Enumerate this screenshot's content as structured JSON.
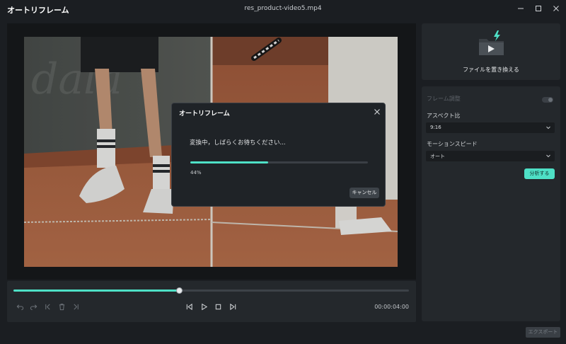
{
  "window": {
    "app_title": "オートリフレーム",
    "file_name": "res_product-video5.mp4",
    "controls": [
      "minimize-icon",
      "maximize-icon",
      "close-icon"
    ]
  },
  "player": {
    "timecode": "00:00:04:00",
    "progress": 0.42,
    "buttons": [
      "undo-icon",
      "redo-icon",
      "split-start-icon",
      "delete-icon",
      "split-end-icon",
      "step-back-icon",
      "play-icon",
      "stop-icon",
      "step-forward-icon"
    ]
  },
  "sidebar": {
    "replace_file_label": "ファイルを置き換える",
    "frame_adjust_label": "フレーム調整",
    "frame_adjust_enabled": false,
    "aspect_ratio_label": "アスペクト比",
    "aspect_ratio_value": "9:16",
    "motion_speed_label": "モーションスピード",
    "motion_speed_value": "オート",
    "analyze_button": "分析する"
  },
  "export_button": "エクスポート",
  "dialog": {
    "title": "オートリフレーム",
    "message": "変換中，しばらくお待ちください...",
    "progress": 0.44,
    "percent_text": "44%",
    "cancel_button": "キャンセル"
  },
  "colors": {
    "accent": "#4ee0c6",
    "background": "#1b1e22",
    "panel": "#24282c"
  }
}
